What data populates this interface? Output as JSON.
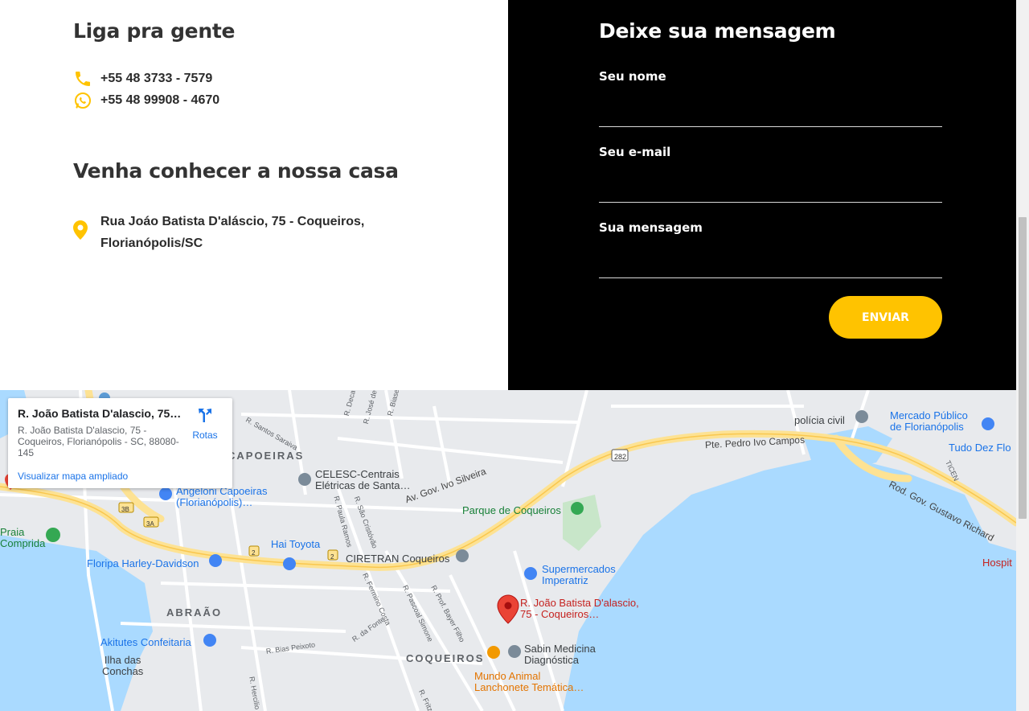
{
  "contact": {
    "call_title": "Liga pra gente",
    "phones": [
      {
        "icon": "phone-icon",
        "number": "+55 48 3733 - 7579"
      },
      {
        "icon": "whatsapp-icon",
        "number": "+55 48 99908 - 4670"
      }
    ],
    "visit_title": "Venha conhecer a nossa casa",
    "address": "Rua Joáo Batista D'aláscio, 75 - Coqueiros, Florianópolis/SC"
  },
  "form": {
    "title": "Deixe sua mensagem",
    "name_label": "Seu nome",
    "name_value": "",
    "email_label": "Seu e-mail",
    "email_value": "",
    "message_label": "Sua mensagem",
    "message_value": "",
    "submit_label": "ENVIAR"
  },
  "colors": {
    "accent": "#ffc300",
    "form_bg": "#000000",
    "heading": "#333333"
  },
  "map": {
    "card": {
      "title": "R. João Batista D'alascio, 75 - …",
      "address": "R. João Batista D'alascio, 75 - Coqueiros, Florianópolis - SC, 88080-145",
      "directions_label": "Rotas",
      "enlarge_link": "Visualizar mapa ampliado"
    },
    "labels": {
      "capoeiras": "CAPOEIRAS",
      "abraao": "ABRAÃO",
      "coqueiros": "COQUEIROS",
      "celesc": "CELESC-Centrais\nElétricas de Santa…",
      "angeloni": "Angeloni Capoeiras\n(Florianópolis)…",
      "praia": "Praia\nComprida",
      "hai_toyota": "Hai Toyota",
      "harley": "Floripa Harley-Davidson",
      "ciretran": "CIRETRAN Coqueiros",
      "parque": "Parque de Coqueiros",
      "supermercados": "Supermercados\nImperatriz",
      "marker": "R. João Batista D'alascio,\n75 - Coqueiros…",
      "sabin": "Sabin Medicina\nDiagnóstica",
      "mundo_animal": "Mundo Animal\nLanchonete Temática…",
      "akitutes": "Akitutes Confeitaria",
      "ilha": "Ilha das\nConchas",
      "policia": "polícia civil",
      "mercado": "Mercado Público\nde Florianópolis",
      "tudo_dez": "Tudo Dez Flo",
      "hospit": "Hospit",
      "pte": "Pte. Pedro Ivo Campos",
      "rod_gov": "Rod. Gov. Gustavo Richard",
      "av_ivo": "Av. Gov. Ivo Silveira",
      "r_santos": "R. Santos Saraiva",
      "r_paula": "R. Paula Ramos",
      "r_sao_cristovao": "R. São Cristóvão",
      "r_fermino": "R. Fermino Costa",
      "r_pascoal": "R. Pascoal Simone",
      "r_bayer": "R. Prof. Bayer Filho",
      "r_fonte": "R. da Fonte",
      "r_bias": "R. Bias Peixoto",
      "r_herculio": "R. Hercilio",
      "r_fritz": "R. Fritz M",
      "ticen": "TICEN",
      "r_jose": "R. José de Pinho",
      "r_biase": "R. Biase",
      "r_deca": "R. Deca",
      "route_282": "282",
      "route_3b": "3B",
      "route_3a": "3A",
      "route_2a": "2",
      "route_2b": "2"
    }
  }
}
